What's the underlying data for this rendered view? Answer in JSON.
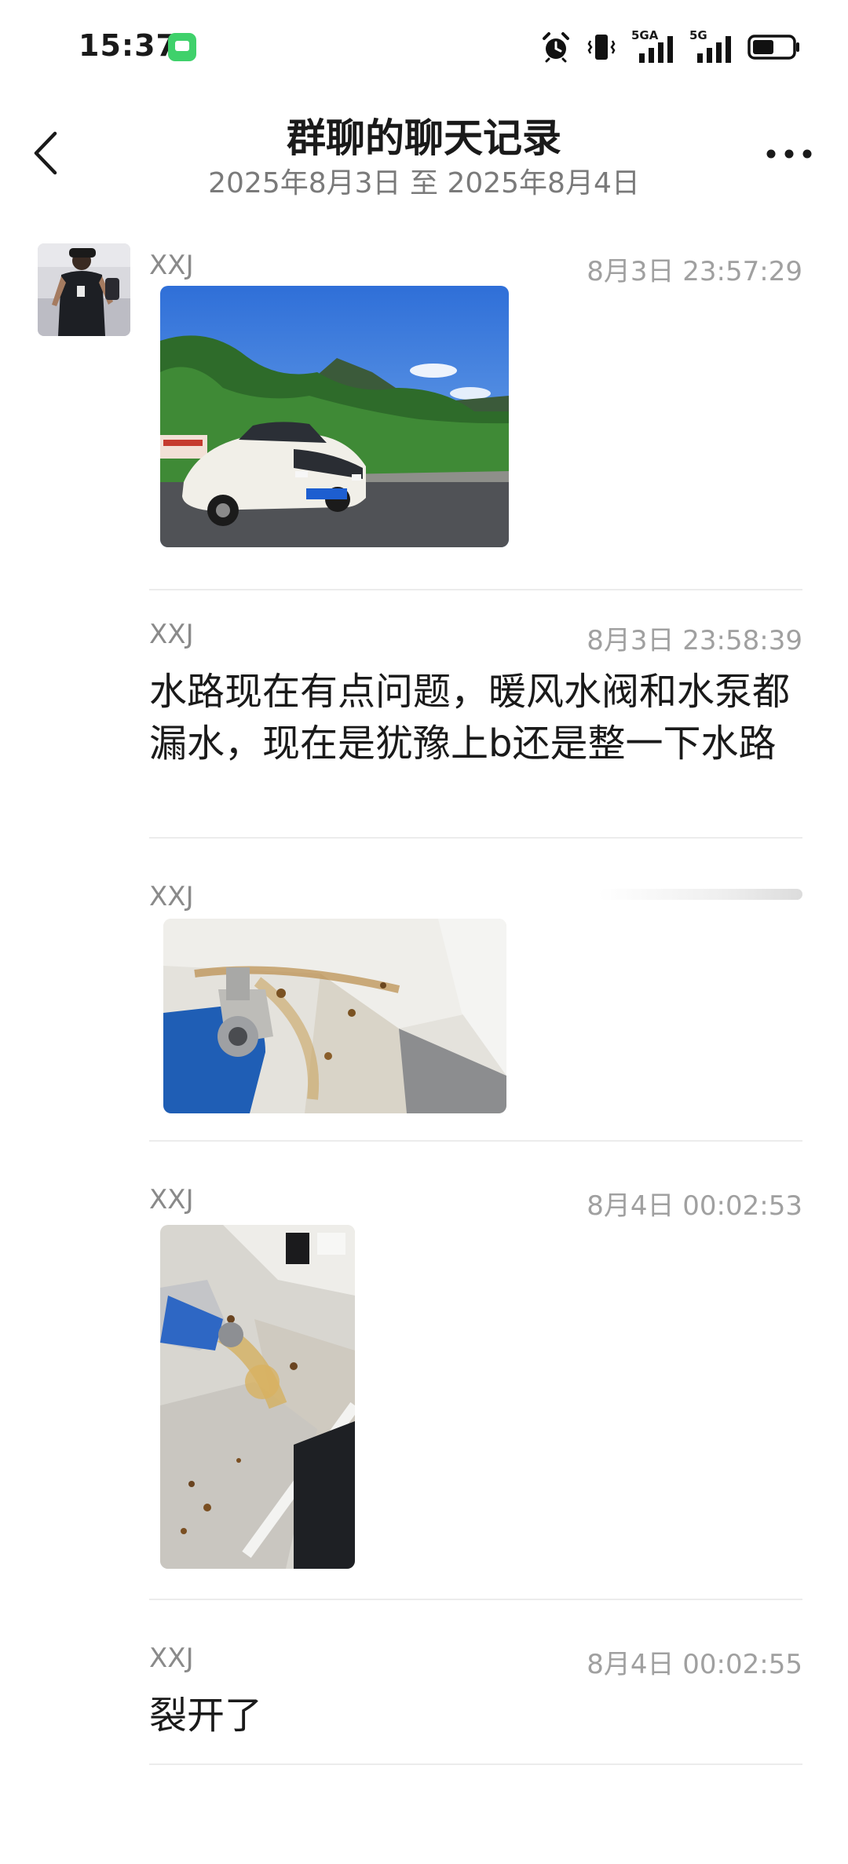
{
  "status_bar": {
    "time": "15:37",
    "network_1": "5GA",
    "network_2": "5G",
    "icons": [
      "messages-app-icon",
      "alarm-icon",
      "vibrate-icon",
      "signal-icon",
      "signal-icon",
      "battery-icon"
    ],
    "battery_level": 0.55
  },
  "header": {
    "title": "群聊的聊天记录",
    "date_range": "2025年8月3日 至 2025年8月4日"
  },
  "messages": [
    {
      "sender": "XXJ",
      "time": "8月3日 23:57:29",
      "type": "image",
      "image": "white-sedan-by-mountain-photo"
    },
    {
      "sender": "XXJ",
      "time": "8月3日 23:58:39",
      "type": "text",
      "text": "水路现在有点问题，暖风水阀和水泵都漏水，现在是犹豫上b还是整一下水路"
    },
    {
      "sender": "XXJ",
      "time": "",
      "type": "image",
      "image": "engine-bay-leak-photo"
    },
    {
      "sender": "XXJ",
      "time": "8月4日 00:02:53",
      "type": "image",
      "image": "strut-tower-rust-photo"
    },
    {
      "sender": "XXJ",
      "time": "8月4日 00:02:55",
      "type": "text",
      "text": "裂开了"
    }
  ],
  "colors": {
    "background": "#ffffff",
    "title": "#1a1a1a",
    "secondary": "#7a7a7a",
    "timestamp": "#a0a0a0",
    "divider": "#ececec"
  }
}
